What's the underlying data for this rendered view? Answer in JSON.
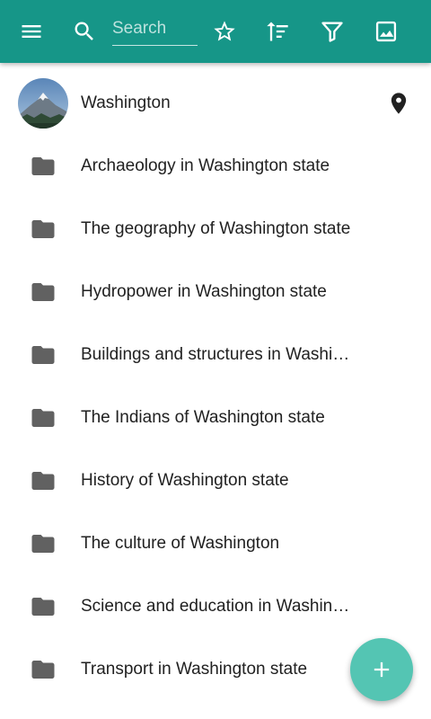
{
  "colors": {
    "toolbar": "#169688",
    "fab": "#54c5b3",
    "folder_icon": "#616161",
    "text": "#212121"
  },
  "toolbar": {
    "menu_icon": "menu-icon",
    "search_icon": "search-icon",
    "search_placeholder": "Search",
    "search_value": "",
    "favorite_icon": "star-outline-icon",
    "sort_icon": "sort-icon",
    "filter_icon": "filter-icon",
    "image_icon": "image-icon"
  },
  "header_item": {
    "title": "Washington",
    "avatar": "mountain-photo",
    "action_icon": "map-marker-icon"
  },
  "folders": [
    {
      "label": "Archaeology in Washington state"
    },
    {
      "label": "The geography of Washington state"
    },
    {
      "label": "Hydropower in Washington state"
    },
    {
      "label": "Buildings and structures in Washington state"
    },
    {
      "label": "The Indians of Washington state"
    },
    {
      "label": "History of Washington state"
    },
    {
      "label": "The culture of Washington"
    },
    {
      "label": "Science and education in Washington state"
    },
    {
      "label": "Transport in Washington state"
    }
  ],
  "fab": {
    "icon": "plus-icon"
  }
}
